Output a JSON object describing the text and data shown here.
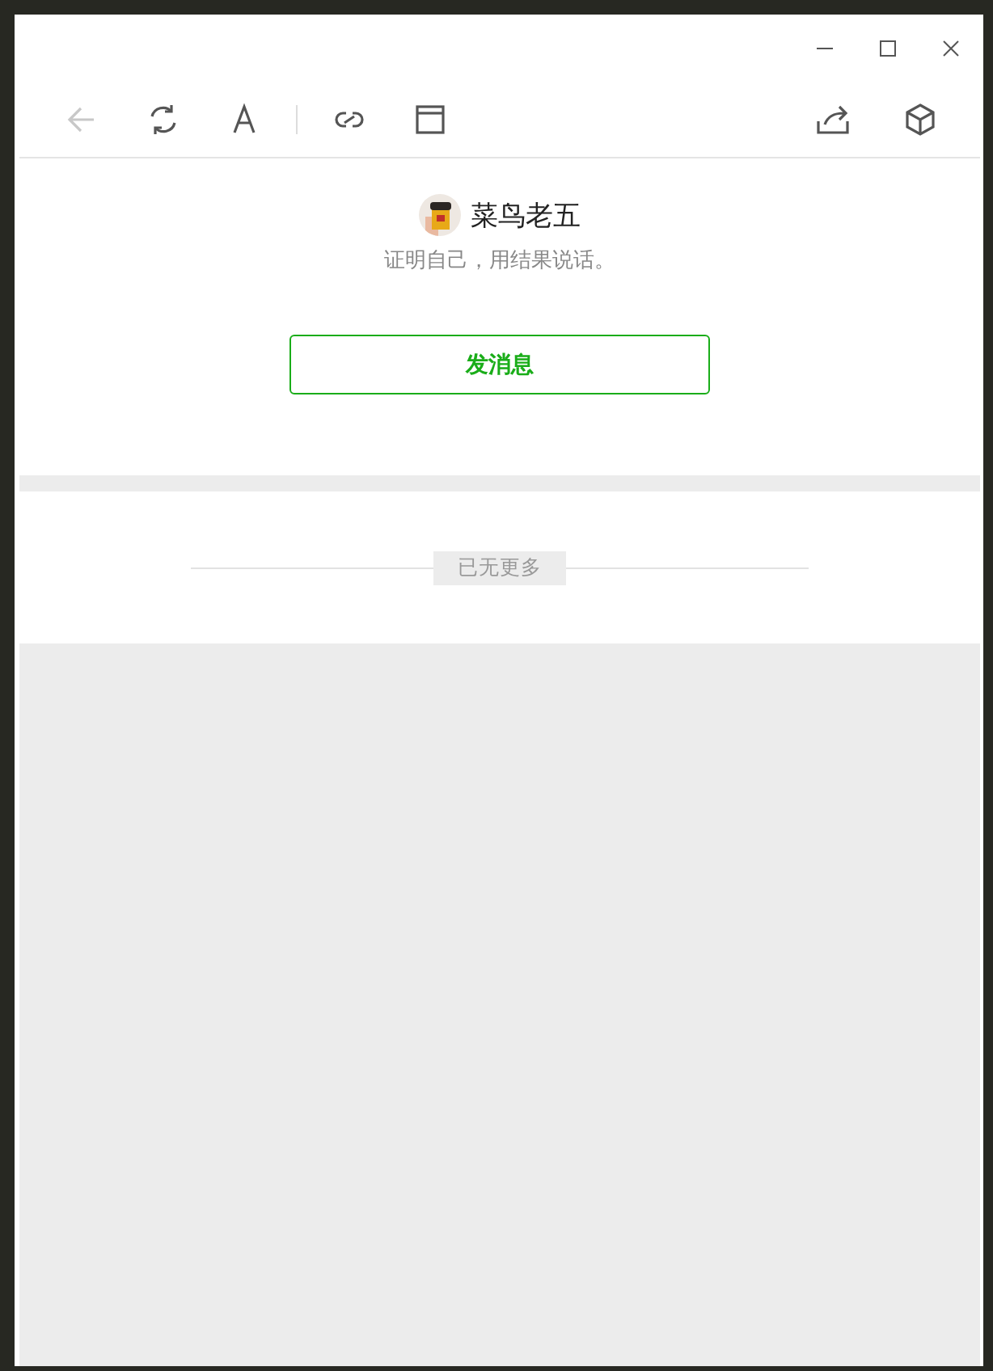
{
  "toolbar": {
    "left": [
      {
        "kind": "back",
        "disabled": true
      },
      {
        "kind": "refresh",
        "disabled": false
      },
      {
        "kind": "font",
        "disabled": false
      },
      {
        "kind": "separator"
      },
      {
        "kind": "link",
        "disabled": false
      },
      {
        "kind": "window",
        "disabled": false
      }
    ],
    "right": [
      {
        "kind": "share",
        "disabled": false
      },
      {
        "kind": "cube",
        "disabled": false
      }
    ]
  },
  "profile": {
    "name": "菜鸟老五",
    "signature": "证明自己，用结果说话。",
    "button": "发消息"
  },
  "feed": {
    "end_label": "已无更多"
  }
}
